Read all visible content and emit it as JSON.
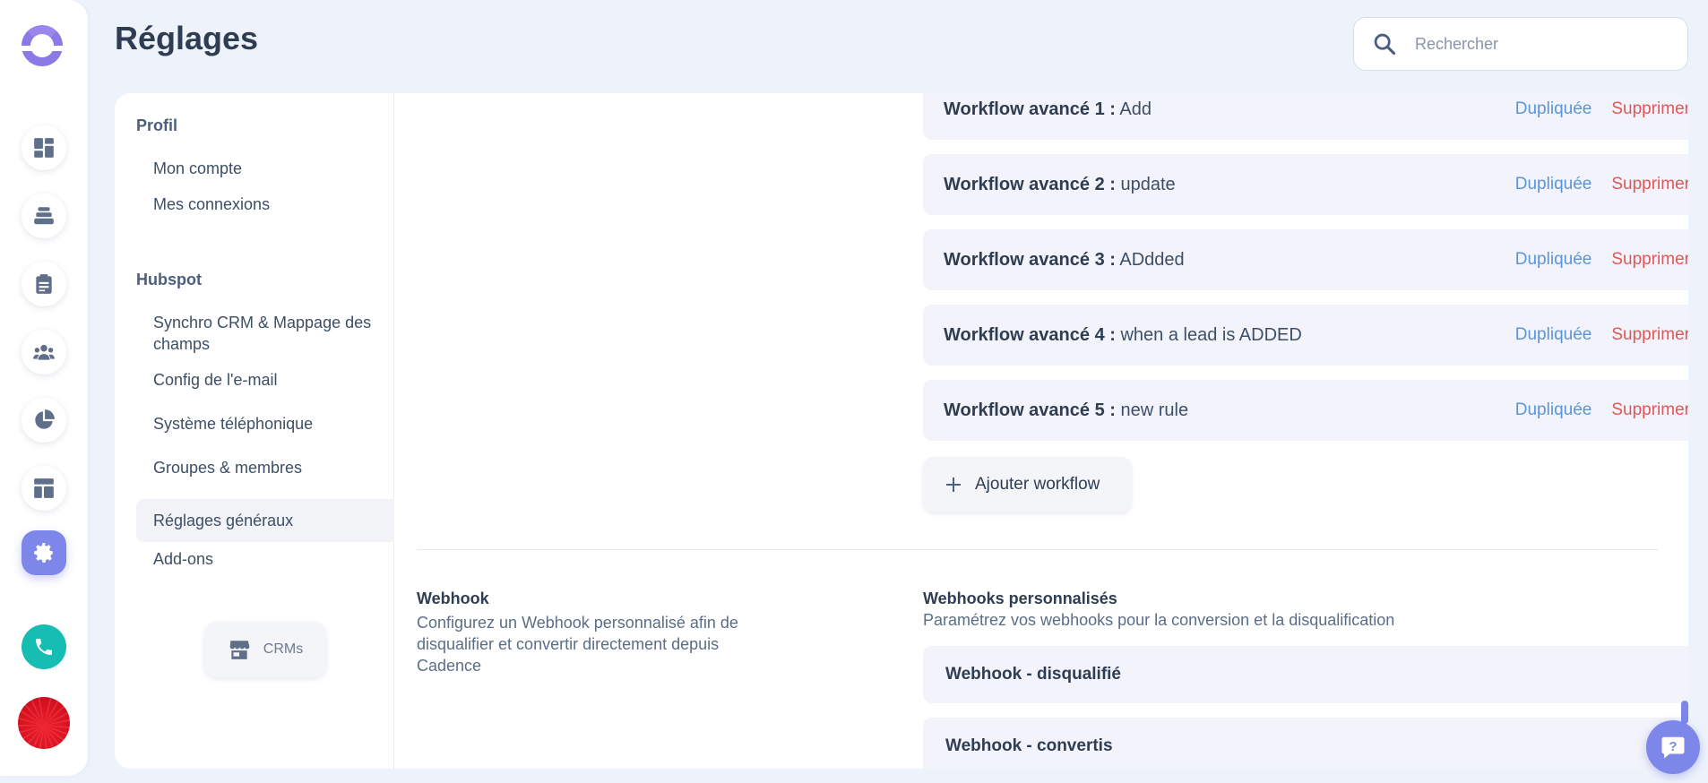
{
  "app": {
    "page_title": "Réglages"
  },
  "search": {
    "placeholder": "Rechercher"
  },
  "sidebar": {
    "items": [
      {
        "icon": "dashboard-icon"
      },
      {
        "icon": "stack-icon"
      },
      {
        "icon": "clipboard-icon"
      },
      {
        "icon": "team-icon"
      },
      {
        "icon": "pie-chart-icon"
      },
      {
        "icon": "layout-icon"
      },
      {
        "icon": "gear-icon",
        "active": true
      }
    ],
    "call_icon": "phone-icon",
    "avatar_icon": "user-avatar"
  },
  "settings_nav": {
    "profile_section": "Profil",
    "profile_items": [
      "Mon compte",
      "Mes connexions"
    ],
    "hubspot_section": "Hubspot",
    "hubspot_items": [
      "Synchro CRM & Mappage des champs",
      "Config de l'e-mail",
      "Système téléphonique",
      "Groupes & membres",
      "Réglages généraux",
      "Add-ons"
    ],
    "selected": "Réglages généraux",
    "crms_button": "CRMs"
  },
  "workflows": {
    "duplicate_label": "Dupliquée",
    "delete_label": "Supprimer",
    "items": [
      {
        "prefix": "Workflow avancé 1 :",
        "name": "Add",
        "enabled": false
      },
      {
        "prefix": "Workflow avancé 2 :",
        "name": "update",
        "enabled": false
      },
      {
        "prefix": "Workflow avancé 3 :",
        "name": "ADdded",
        "enabled": false
      },
      {
        "prefix": "Workflow avancé 4 :",
        "name": "when a lead is ADDED",
        "enabled": false
      },
      {
        "prefix": "Workflow avancé 5 :",
        "name": "new rule",
        "enabled": true
      }
    ],
    "add_label": "Ajouter workflow"
  },
  "webhook": {
    "title": "Webhook",
    "description": "Configurez un Webhook personnalisé afin de disqualifier et convertir directement depuis Cadence",
    "custom_title": "Webhooks personnalisés",
    "custom_description": "Paramétrez vos webhooks pour la conversion et la disqualification",
    "items": [
      "Webhook - disqualifié",
      "Webhook - convertis"
    ]
  },
  "colors": {
    "accent": "#7d87ea",
    "link_blue": "#5b95d9",
    "danger": "#e25656",
    "call_green": "#16bdb2"
  }
}
